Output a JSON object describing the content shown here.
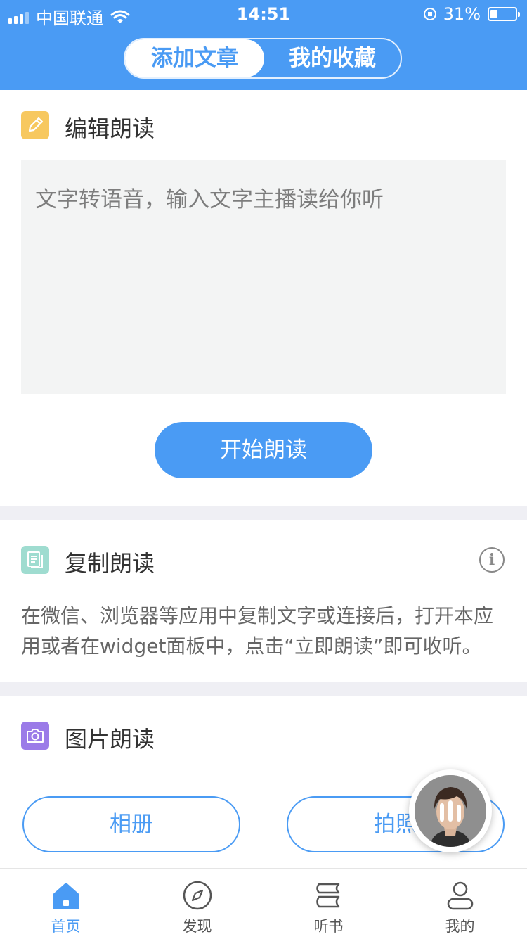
{
  "status_bar": {
    "carrier": "中国联通",
    "time": "14:51",
    "battery": "31%"
  },
  "header": {
    "tabs": [
      {
        "label": "添加文章"
      },
      {
        "label": "我的收藏"
      }
    ]
  },
  "edit_read": {
    "title": "编辑朗读",
    "placeholder": "文字转语音，输入文字主播读给你听",
    "start_button": "开始朗读"
  },
  "copy_read": {
    "title": "复制朗读",
    "info": "i",
    "description": "在微信、浏览器等应用中复制文字或连接后，打开本应用或者在widget面板中，点击“立即朗读”即可收听。"
  },
  "image_read": {
    "title": "图片朗读",
    "album_button": "相册",
    "camera_button": "拍照"
  },
  "tabbar": {
    "items": [
      {
        "label": "首页",
        "icon": "home-icon"
      },
      {
        "label": "发现",
        "icon": "compass-icon"
      },
      {
        "label": "听书",
        "icon": "books-icon"
      },
      {
        "label": "我的",
        "icon": "user-icon"
      }
    ]
  },
  "colors": {
    "accent": "#4a9bf4",
    "background": "#efeff4"
  }
}
